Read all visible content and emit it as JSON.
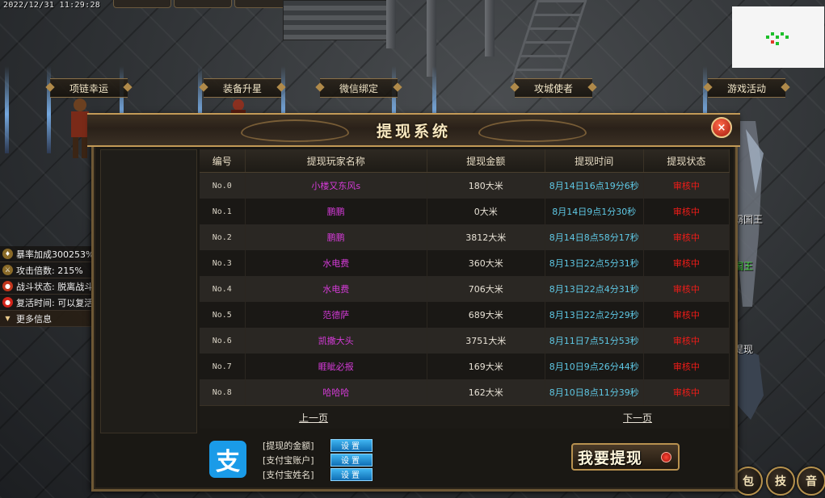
{
  "game": {
    "timestamp": "2022/12/31 11:29:28",
    "npc_labels": [
      "项链幸运",
      "装备升星",
      "微信绑定",
      "攻城使者",
      "游戏活动"
    ],
    "side_labels": [
      "霸国王",
      "国王",
      "提现"
    ],
    "stats": [
      {
        "icon": "power-icon",
        "text": "暴率加成300253%"
      },
      {
        "icon": "attack-icon",
        "text": "攻击倍数: 215%"
      },
      {
        "icon": "combat-icon",
        "text": "战斗状态: 脱离战斗"
      },
      {
        "icon": "revive-icon",
        "text": "复活时间: 可以复活"
      },
      {
        "icon": "chevron-down-icon",
        "text": "更多信息"
      }
    ],
    "round_buttons": [
      "包",
      "技",
      "音"
    ]
  },
  "dialog": {
    "title": "提现系统",
    "close": "×",
    "columns": [
      "编号",
      "提现玩家名称",
      "提现金额",
      "提现时间",
      "提现状态"
    ],
    "rows": [
      {
        "no": "No.0",
        "name": "小楼又东风s",
        "amount": "180大米",
        "time": "8月14日16点19分6秒",
        "status": "审核中"
      },
      {
        "no": "No.1",
        "name": "鹏鹏",
        "amount": "0大米",
        "time": "8月14日9点1分30秒",
        "status": "审核中"
      },
      {
        "no": "No.2",
        "name": "鹏鹏",
        "amount": "3812大米",
        "time": "8月14日8点58分17秒",
        "status": "审核中"
      },
      {
        "no": "No.3",
        "name": "水电费",
        "amount": "360大米",
        "time": "8月13日22点5分31秒",
        "status": "审核中"
      },
      {
        "no": "No.4",
        "name": "水电费",
        "amount": "706大米",
        "time": "8月13日22点4分31秒",
        "status": "审核中"
      },
      {
        "no": "No.5",
        "name": "范德萨",
        "amount": "689大米",
        "time": "8月13日22点2分29秒",
        "status": "审核中"
      },
      {
        "no": "No.6",
        "name": "凯撒大头",
        "amount": "3751大米",
        "time": "8月11日7点51分53秒",
        "status": "审核中"
      },
      {
        "no": "No.7",
        "name": "睚眦必报",
        "amount": "169大米",
        "time": "8月10日9点26分44秒",
        "status": "审核中"
      },
      {
        "no": "No.8",
        "name": "哈哈哈",
        "amount": "162大米",
        "time": "8月10日8点11分39秒",
        "status": "审核中"
      }
    ],
    "pager": {
      "prev": "上一页",
      "next": "下一页"
    },
    "alipay_glyph": "支",
    "settings": [
      {
        "label": "[提现的金额]",
        "button": "设置"
      },
      {
        "label": "[支付宝账户]",
        "button": "设置"
      },
      {
        "label": "[支付宝姓名]",
        "button": "设置"
      }
    ],
    "withdraw_button": "我要提现",
    "colors": {
      "name": "#d43bd7",
      "time": "#5fc9e6",
      "status": "#f21c18",
      "frame": "#c39a57"
    }
  }
}
